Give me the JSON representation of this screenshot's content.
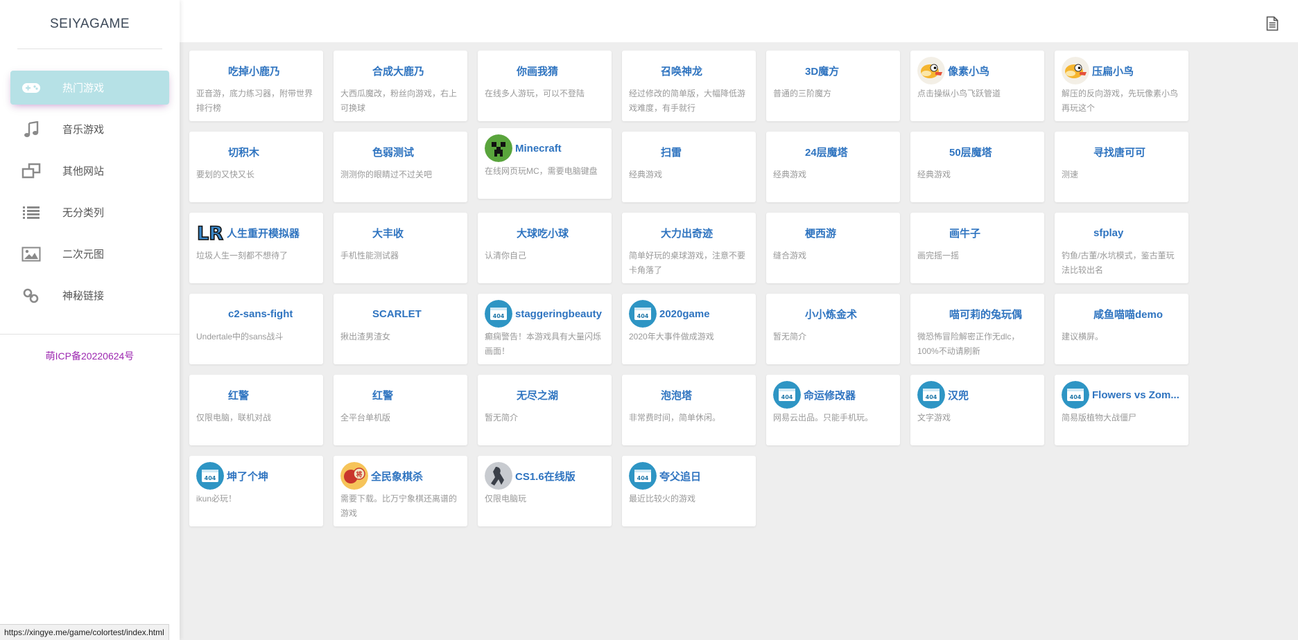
{
  "brand": "SEIYAGAME",
  "nav": [
    {
      "label": "热门游戏",
      "icon": "gamepad-icon",
      "active": true
    },
    {
      "label": "音乐游戏",
      "icon": "music-note-icon",
      "active": false
    },
    {
      "label": "其他网站",
      "icon": "windows-icon",
      "active": false
    },
    {
      "label": "无分类列",
      "icon": "list-icon",
      "active": false
    },
    {
      "label": "二次元图",
      "icon": "image-icon",
      "active": false
    },
    {
      "label": "神秘链接",
      "icon": "link-icon",
      "active": false
    }
  ],
  "icp": "萌ICP备20220624号",
  "status_url": "https://xingye.me/game/colortest/index.html",
  "colors": {
    "accent": "#b6e1e6",
    "title": "#2f74c0",
    "icp": "#9c27b0"
  },
  "cards": [
    {
      "title": "吃掉小鹿乃",
      "desc": "亚音游，底力练习器，附带世界排行榜",
      "thumb": "none"
    },
    {
      "title": "合成大鹿乃",
      "desc": "大西瓜魔改，粉丝向游戏，右上可换球",
      "thumb": "none"
    },
    {
      "title": "你画我猜",
      "desc": "在线多人游玩，可以不登陆",
      "thumb": "none"
    },
    {
      "title": "召唤神龙",
      "desc": "经过修改的简单版，大幅降低游戏难度，有手就行",
      "thumb": "none"
    },
    {
      "title": "3D魔方",
      "desc": "普通的三阶魔方",
      "thumb": "none"
    },
    {
      "title": "像素小鸟",
      "desc": "点击操纵小鸟飞跃管道",
      "thumb": "bird"
    },
    {
      "title": "压扁小鸟",
      "desc": "解压的反向游戏，先玩像素小鸟再玩这个",
      "thumb": "bird"
    },
    {
      "title": "切积木",
      "desc": "要划的又快又长",
      "thumb": "none"
    },
    {
      "title": "色弱测试",
      "desc": "测测你的眼睛过不过关吧",
      "thumb": "none"
    },
    {
      "title": "Minecraft",
      "desc": "在线网页玩MC，需要电脑键盘",
      "thumb": "creeper"
    },
    {
      "title": "扫雷",
      "desc": "经典游戏",
      "thumb": "none"
    },
    {
      "title": "24层魔塔",
      "desc": "经典游戏",
      "thumb": "none"
    },
    {
      "title": "50层魔塔",
      "desc": "经典游戏",
      "thumb": "none"
    },
    {
      "title": "寻找唐可可",
      "desc": "测速",
      "thumb": "none"
    },
    {
      "title": "人生重开模拟器",
      "desc": "垃圾人生一刻都不想待了",
      "thumb": "lr"
    },
    {
      "title": "大丰收",
      "desc": "手机性能测试器",
      "thumb": "none"
    },
    {
      "title": "大球吃小球",
      "desc": "认清你自己",
      "thumb": "none"
    },
    {
      "title": "大力出奇迹",
      "desc": "简单好玩的桌球游戏，注意不要卡角落了",
      "thumb": "none"
    },
    {
      "title": "梗西游",
      "desc": "缝合游戏",
      "thumb": "none"
    },
    {
      "title": "画牛子",
      "desc": "画完摇一摇",
      "thumb": "none"
    },
    {
      "title": "sfplay",
      "desc": "钓鱼/古董/水坑模式，鉴古董玩法比较出名",
      "thumb": "none"
    },
    {
      "title": "c2-sans-fight",
      "desc": "Undertale中的sans战斗",
      "thumb": "none"
    },
    {
      "title": "SCARLET",
      "desc": "揪出渣男渣女",
      "thumb": "none"
    },
    {
      "title": "staggeringbeauty",
      "desc": "癫痫警告！本游戏具有大量闪烁画面！",
      "thumb": "404"
    },
    {
      "title": "2020game",
      "desc": "2020年大事件做成游戏",
      "thumb": "404"
    },
    {
      "title": "小小炼金术",
      "desc": "暂无简介",
      "thumb": "none"
    },
    {
      "title": "喵可莉的兔玩偶",
      "desc": "微恐怖冒险解密正作无dlc，100%不动请刷新",
      "thumb": "none"
    },
    {
      "title": "咸鱼喵喵demo",
      "desc": "建议横屏。",
      "thumb": "none"
    },
    {
      "title": "红警",
      "desc": "仅限电脑，联机对战",
      "thumb": "none"
    },
    {
      "title": "红警",
      "desc": "全平台单机版",
      "thumb": "none"
    },
    {
      "title": "无尽之湖",
      "desc": "暂无简介",
      "thumb": "none"
    },
    {
      "title": "泡泡塔",
      "desc": "非常费时间，简单休闲。",
      "thumb": "none"
    },
    {
      "title": "命运修改器",
      "desc": "网易云出品。只能手机玩。",
      "thumb": "404"
    },
    {
      "title": "汉兜",
      "desc": "文字游戏",
      "thumb": "404"
    },
    {
      "title": "Flowers vs Zom...",
      "desc": "简易版植物大战僵尸",
      "thumb": "404"
    },
    {
      "title": "坤了个坤",
      "desc": "ikun必玩！",
      "thumb": "404"
    },
    {
      "title": "全民象棋杀",
      "desc": "需要下载。比万宁象棋还离谱的游戏",
      "thumb": "chess"
    },
    {
      "title": "CS1.6在线版",
      "desc": "仅限电脑玩",
      "thumb": "cs"
    },
    {
      "title": "夸父追日",
      "desc": "最近比较火的游戏",
      "thumb": "404"
    }
  ]
}
